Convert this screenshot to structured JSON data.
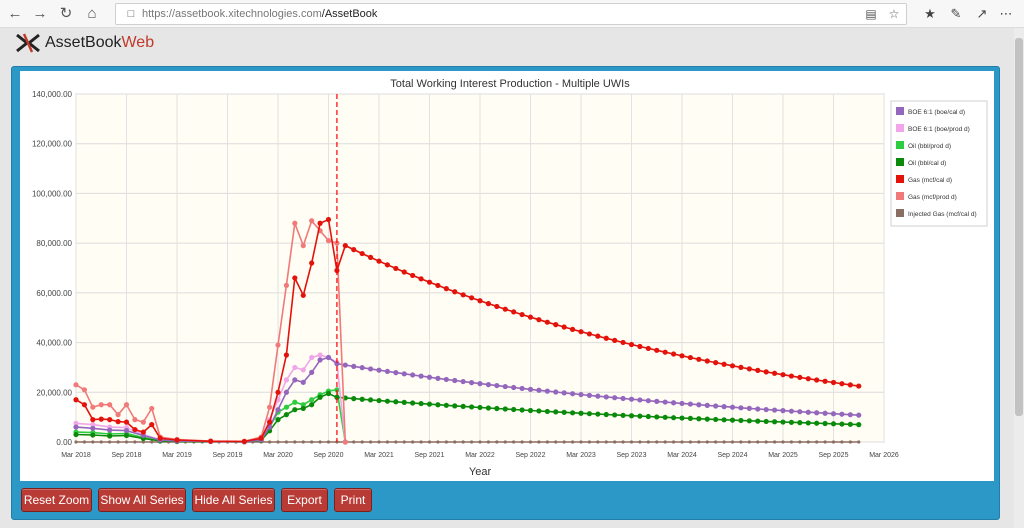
{
  "browser": {
    "url_host": "https://assetbook.xitechnologies.com",
    "url_path": "/AssetBook"
  },
  "app": {
    "logo_main": "AssetBook",
    "logo_accent": "Web"
  },
  "buttons": {
    "reset_zoom": "Reset Zoom",
    "show_all": "Show All Series",
    "hide_all": "Hide All Series",
    "export": "Export",
    "print": "Print"
  },
  "chart_data": {
    "type": "line",
    "title": "Total Working Interest Production - Multiple UWIs",
    "xlabel": "Year",
    "ylabel": "",
    "ylim": [
      0,
      140000
    ],
    "y_ticks": [
      0,
      20000,
      40000,
      60000,
      80000,
      100000,
      120000,
      140000
    ],
    "y_tick_labels": [
      "0.00",
      "20,000.00",
      "40,000.00",
      "60,000.00",
      "80,000.00",
      "100,000.00",
      "120,000.00",
      "140,000.00"
    ],
    "x_range": [
      "2018-03",
      "2026-03"
    ],
    "x_tick_labels": [
      "Mar 2018",
      "Sep 2018",
      "Mar 2019",
      "Sep 2019",
      "Mar 2020",
      "Sep 2020",
      "Mar 2021",
      "Sep 2021",
      "Mar 2022",
      "Sep 2022",
      "Mar 2023",
      "Sep 2023",
      "Mar 2024",
      "Sep 2024",
      "Mar 2025",
      "Sep 2025",
      "Mar 2026"
    ],
    "grid": true,
    "legend_position": "right",
    "vertical_marker": {
      "date": "2020-10",
      "color": "#ff0000",
      "style": "dashed"
    },
    "series": [
      {
        "name": "BOE 6:1 (boe/cal d)",
        "color": "#9467bd",
        "points": [
          [
            "2018-03",
            6000
          ],
          [
            "2018-05",
            5500
          ],
          [
            "2018-07",
            4800
          ],
          [
            "2018-09",
            4600
          ],
          [
            "2018-11",
            2600
          ],
          [
            "2019-01",
            800
          ],
          [
            "2019-03",
            400
          ],
          [
            "2019-07",
            200
          ],
          [
            "2019-11",
            100
          ],
          [
            "2020-01",
            900
          ],
          [
            "2020-02",
            6000
          ],
          [
            "2020-03",
            13000
          ],
          [
            "2020-04",
            20000
          ],
          [
            "2020-05",
            25000
          ],
          [
            "2020-06",
            24000
          ],
          [
            "2020-07",
            28000
          ],
          [
            "2020-08",
            33000
          ],
          [
            "2020-09",
            34000
          ],
          [
            "2020-10",
            31500
          ]
        ],
        "forecast": {
          "start": "2020-10",
          "end": "2025-12",
          "start_value": 31500,
          "end_value": 10800
        }
      },
      {
        "name": "BOE 6:1 (boe/prod d)",
        "color": "#f0a6e8",
        "points": [
          [
            "2018-03",
            7500
          ],
          [
            "2018-05",
            7000
          ],
          [
            "2018-07",
            6000
          ],
          [
            "2018-09",
            5800
          ],
          [
            "2018-11",
            3000
          ],
          [
            "2019-01",
            900
          ],
          [
            "2019-03",
            500
          ],
          [
            "2019-11",
            100
          ],
          [
            "2020-01",
            1500
          ],
          [
            "2020-02",
            9000
          ],
          [
            "2020-03",
            17000
          ],
          [
            "2020-04",
            25000
          ],
          [
            "2020-05",
            30000
          ],
          [
            "2020-06",
            29000
          ],
          [
            "2020-07",
            34000
          ],
          [
            "2020-08",
            35000
          ],
          [
            "2020-09",
            34000
          ],
          [
            "2020-10",
            32000
          ],
          [
            "2020-11",
            0
          ]
        ]
      },
      {
        "name": "Oil (bbl/prod d)",
        "color": "#2ecc40",
        "points": [
          [
            "2018-03",
            4000
          ],
          [
            "2018-05",
            3800
          ],
          [
            "2018-07",
            3200
          ],
          [
            "2018-09",
            3400
          ],
          [
            "2018-11",
            1800
          ],
          [
            "2019-01",
            600
          ],
          [
            "2019-03",
            300
          ],
          [
            "2019-11",
            100
          ],
          [
            "2020-01",
            1000
          ],
          [
            "2020-02",
            6000
          ],
          [
            "2020-03",
            12000
          ],
          [
            "2020-04",
            14000
          ],
          [
            "2020-05",
            16000
          ],
          [
            "2020-06",
            15000
          ],
          [
            "2020-07",
            17000
          ],
          [
            "2020-08",
            19000
          ],
          [
            "2020-09",
            20500
          ],
          [
            "2020-10",
            21000
          ],
          [
            "2020-11",
            0
          ]
        ]
      },
      {
        "name": "Oil (bbl/cal d)",
        "color": "#0a8a0a",
        "points": [
          [
            "2018-03",
            3000
          ],
          [
            "2018-05",
            2800
          ],
          [
            "2018-07",
            2400
          ],
          [
            "2018-09",
            2600
          ],
          [
            "2018-11",
            1400
          ],
          [
            "2019-01",
            400
          ],
          [
            "2019-03",
            200
          ],
          [
            "2019-11",
            100
          ],
          [
            "2020-01",
            700
          ],
          [
            "2020-02",
            4500
          ],
          [
            "2020-03",
            9000
          ],
          [
            "2020-04",
            11000
          ],
          [
            "2020-05",
            13000
          ],
          [
            "2020-06",
            13500
          ],
          [
            "2020-07",
            15000
          ],
          [
            "2020-08",
            18000
          ],
          [
            "2020-09",
            19500
          ],
          [
            "2020-10",
            18000
          ]
        ],
        "forecast": {
          "start": "2020-10",
          "end": "2025-12",
          "start_value": 18000,
          "end_value": 7000
        }
      },
      {
        "name": "Gas (mcf/cal d)",
        "color": "#e3120b",
        "points": [
          [
            "2018-03",
            17000
          ],
          [
            "2018-04",
            15000
          ],
          [
            "2018-05",
            9000
          ],
          [
            "2018-06",
            9200
          ],
          [
            "2018-07",
            9000
          ],
          [
            "2018-08",
            8200
          ],
          [
            "2018-09",
            8000
          ],
          [
            "2018-10",
            5000
          ],
          [
            "2018-11",
            4000
          ],
          [
            "2018-12",
            7000
          ],
          [
            "2019-01",
            1500
          ],
          [
            "2019-03",
            800
          ],
          [
            "2019-07",
            300
          ],
          [
            "2019-11",
            200
          ],
          [
            "2020-01",
            1500
          ],
          [
            "2020-02",
            8000
          ],
          [
            "2020-03",
            20000
          ],
          [
            "2020-04",
            35000
          ],
          [
            "2020-05",
            66000
          ],
          [
            "2020-06",
            59000
          ],
          [
            "2020-07",
            72000
          ],
          [
            "2020-08",
            88000
          ],
          [
            "2020-09",
            89500
          ],
          [
            "2020-10",
            69000
          ],
          [
            "2020-11",
            79000
          ]
        ],
        "forecast": {
          "start": "2020-11",
          "end": "2025-12",
          "start_value": 79000,
          "end_value": 22500
        }
      },
      {
        "name": "Gas (mcf/prod d)",
        "color": "#f07a7a",
        "points": [
          [
            "2018-03",
            23000
          ],
          [
            "2018-04",
            21000
          ],
          [
            "2018-05",
            14000
          ],
          [
            "2018-06",
            15000
          ],
          [
            "2018-07",
            15000
          ],
          [
            "2018-08",
            11000
          ],
          [
            "2018-09",
            15000
          ],
          [
            "2018-10",
            9000
          ],
          [
            "2018-11",
            8000
          ],
          [
            "2018-12",
            13500
          ],
          [
            "2019-01",
            2000
          ],
          [
            "2019-03",
            1000
          ],
          [
            "2019-07",
            400
          ],
          [
            "2019-11",
            300
          ],
          [
            "2020-01",
            2000
          ],
          [
            "2020-02",
            14000
          ],
          [
            "2020-03",
            39000
          ],
          [
            "2020-04",
            63000
          ],
          [
            "2020-05",
            88000
          ],
          [
            "2020-06",
            79000
          ],
          [
            "2020-07",
            89000
          ],
          [
            "2020-08",
            85000
          ],
          [
            "2020-09",
            81000
          ],
          [
            "2020-10",
            80000
          ],
          [
            "2020-11",
            0
          ]
        ]
      },
      {
        "name": "Injected Gas (mcf/cal d)",
        "color": "#8c6d62",
        "points": [
          [
            "2018-03",
            0
          ],
          [
            "2025-12",
            0
          ]
        ]
      }
    ]
  }
}
